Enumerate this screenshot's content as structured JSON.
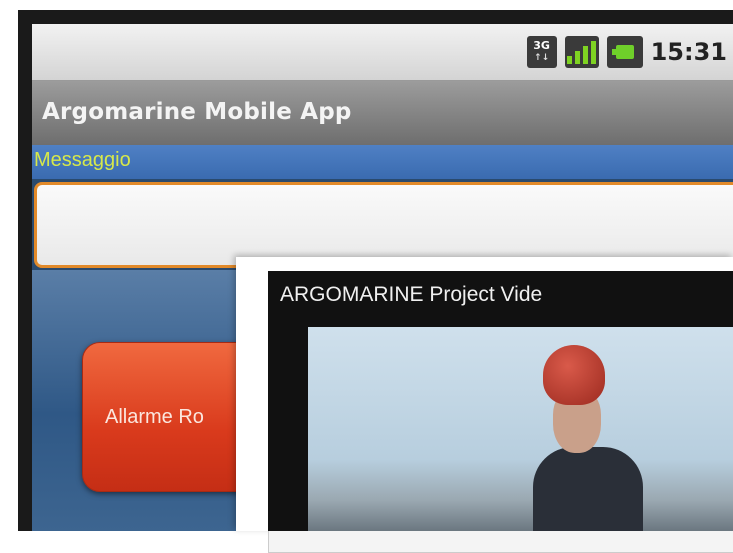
{
  "status_bar": {
    "network_type": "3G",
    "network_arrows": "↑↓",
    "time": "15:31"
  },
  "app": {
    "title": "Argomarine Mobile App"
  },
  "form": {
    "message_label": "Messaggio",
    "message_value": "",
    "alarm_button_label": "Allarme Ro"
  },
  "video": {
    "title": "ARGOMARINE Project Vide"
  },
  "colors": {
    "title_bar": "#7e7e7e",
    "label_strip": "#4477bb",
    "label_text": "#d7e84a",
    "input_border": "#e28a2a",
    "alarm_button": "#d93a1c"
  },
  "icons": [
    "network-3g-icon",
    "signal-strength-icon",
    "battery-icon",
    "person-helmet-icon"
  ]
}
